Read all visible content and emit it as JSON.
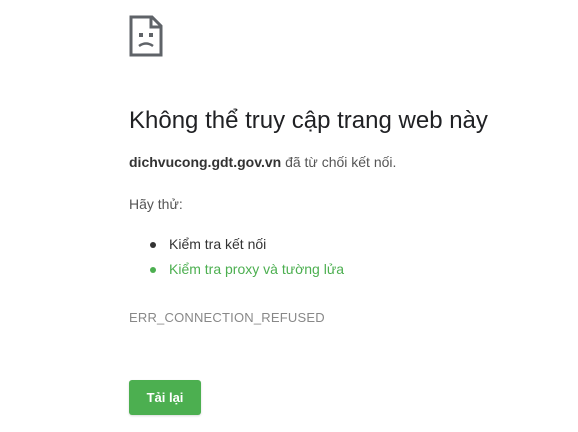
{
  "error_page": {
    "icon": "sad-page-icon",
    "title": "Không thể truy cập trang web này",
    "host": "dichvucong.gdt.gov.vn",
    "summary_suffix": " đã từ chối kết nối.",
    "try_label": "Hãy thử:",
    "suggestions": [
      {
        "label": "Kiểm tra kết nối",
        "is_link": false
      },
      {
        "label": "Kiểm tra proxy và tường lửa",
        "is_link": true
      }
    ],
    "error_code": "ERR_CONNECTION_REFUSED",
    "reload_label": "Tải lại"
  },
  "colors": {
    "accent": "#4caf50",
    "text": "#333333",
    "muted": "#888888"
  }
}
